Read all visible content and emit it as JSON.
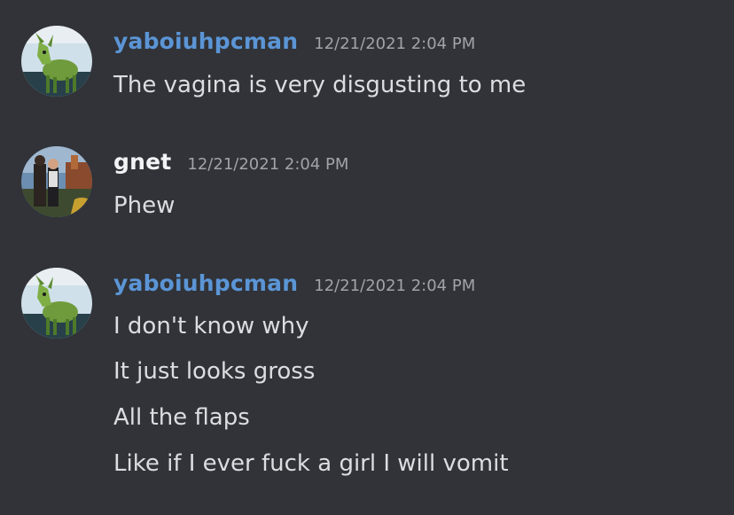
{
  "colors": {
    "background": "#313338",
    "username_blue": "#5b95d6",
    "username_white": "#f2f3f5",
    "timestamp": "#a0a3a9",
    "message_text": "#dbdee1"
  },
  "messages": [
    {
      "username": "yaboiuhpcman",
      "avatar": "deer-avatar-icon",
      "timestamp": "12/21/2021 2:04 PM",
      "lines": [
        "The vagina is very disgusting to me"
      ]
    },
    {
      "username": "gnet",
      "avatar": "person-photo-avatar-icon",
      "timestamp": "12/21/2021 2:04 PM",
      "lines": [
        "Phew"
      ]
    },
    {
      "username": "yaboiuhpcman",
      "avatar": "deer-avatar-icon",
      "timestamp": "12/21/2021 2:04 PM",
      "lines": [
        "I don't know why",
        "It just looks gross",
        "All the flaps",
        "Like if I ever fuck a girl I will vomit"
      ]
    }
  ]
}
